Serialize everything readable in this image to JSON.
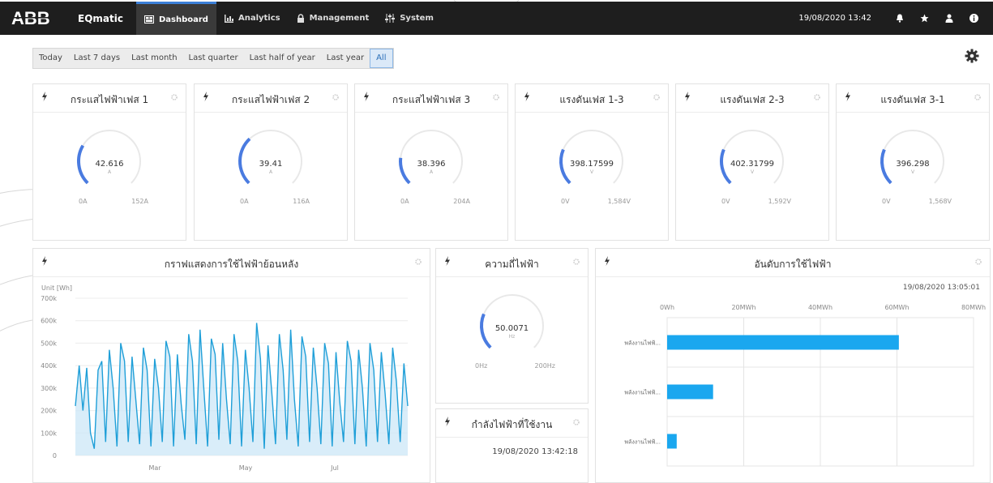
{
  "nav": {
    "app_name": "EQmatic",
    "tabs": [
      {
        "label": "Dashboard",
        "icon": "dashboard-icon"
      },
      {
        "label": "Analytics",
        "icon": "bar-chart-icon"
      },
      {
        "label": "Management",
        "icon": "lock-icon"
      },
      {
        "label": "System",
        "icon": "sliders-icon"
      }
    ],
    "datetime": "19/08/2020 13:42",
    "icons": [
      "bell-icon",
      "star-icon",
      "user-icon",
      "info-icon"
    ]
  },
  "ranges": [
    "Today",
    "Last 7 days",
    "Last month",
    "Last quarter",
    "Last half of year",
    "Last year",
    "All"
  ],
  "active_range": "All",
  "gauges": [
    {
      "title": "กระแสไฟฟ้าเฟส 1",
      "value": "42.616",
      "unit": "A",
      "min": "0A",
      "max": "152A",
      "fraction": 0.28
    },
    {
      "title": "กระแสไฟฟ้าเฟส 2",
      "value": "39.41",
      "unit": "A",
      "min": "0A",
      "max": "116A",
      "fraction": 0.34
    },
    {
      "title": "กระแสไฟฟ้าเฟส 3",
      "value": "38.396",
      "unit": "A",
      "min": "0A",
      "max": "204A",
      "fraction": 0.19
    },
    {
      "title": "แรงดันเฟส 1-3",
      "value": "398.17599",
      "unit": "V",
      "min": "0V",
      "max": "1,584V",
      "fraction": 0.25
    },
    {
      "title": "แรงดันเฟส 2-3",
      "value": "402.31799",
      "unit": "V",
      "min": "0V",
      "max": "1,592V",
      "fraction": 0.25
    },
    {
      "title": "แรงดันเฟส 3-1",
      "value": "396.298",
      "unit": "V",
      "min": "0V",
      "max": "1,568V",
      "fraction": 0.25
    }
  ],
  "frequency": {
    "title": "ความถี่ไฟฟ้า",
    "value": "50.0071",
    "unit": "Hz",
    "min": "0Hz",
    "max": "200Hz",
    "fraction": 0.25
  },
  "power_card": {
    "title": "กำลังไฟฟ้าที่ใช้งาน",
    "timestamp": "19/08/2020 13:42:18"
  },
  "colors": {
    "accent": "#3b7fd8",
    "gauge": "#4a7be0",
    "line": "#1f9fd8",
    "bar": "#1aa7ef"
  },
  "chart_data": [
    {
      "type": "area",
      "title": "กราฟแสดงการใช้ไฟฟ้าย้อนหลัง",
      "ylabel": "Unit [Wh]",
      "ylim": [
        0,
        700000
      ],
      "yticks": [
        "0",
        "100k",
        "200k",
        "300k",
        "400k",
        "500k",
        "600k",
        "700k"
      ],
      "xticks": [
        "Mar",
        "May",
        "Jul"
      ],
      "grid": true,
      "values": [
        220000,
        400000,
        200000,
        390000,
        100000,
        30000,
        380000,
        420000,
        60000,
        470000,
        300000,
        40000,
        500000,
        420000,
        60000,
        440000,
        250000,
        50000,
        480000,
        380000,
        40000,
        430000,
        300000,
        60000,
        510000,
        440000,
        40000,
        450000,
        230000,
        70000,
        540000,
        420000,
        50000,
        560000,
        300000,
        40000,
        520000,
        450000,
        70000,
        500000,
        250000,
        50000,
        540000,
        420000,
        40000,
        470000,
        300000,
        60000,
        590000,
        430000,
        30000,
        490000,
        280000,
        50000,
        540000,
        380000,
        70000,
        560000,
        250000,
        40000,
        530000,
        440000,
        60000,
        480000,
        300000,
        50000,
        500000,
        410000,
        40000,
        460000,
        240000,
        60000,
        510000,
        420000,
        50000,
        470000,
        300000,
        40000,
        500000,
        380000,
        60000,
        460000,
        280000,
        50000,
        480000,
        330000,
        60000,
        410000,
        220000
      ]
    },
    {
      "type": "bar",
      "title": "อันดับการใช้ไฟฟ้า",
      "timestamp": "19/08/2020 13:05:01",
      "xticks": [
        "0Wh",
        "20MWh",
        "40MWh",
        "60MWh",
        "80MWh"
      ],
      "xlim": [
        0,
        80
      ],
      "categories": [
        "พลังงานไฟฟ้...",
        "พลังงานไฟฟ้...",
        "พลังงานไฟฟ้..."
      ],
      "values": [
        60.5,
        12,
        2.5
      ]
    }
  ]
}
